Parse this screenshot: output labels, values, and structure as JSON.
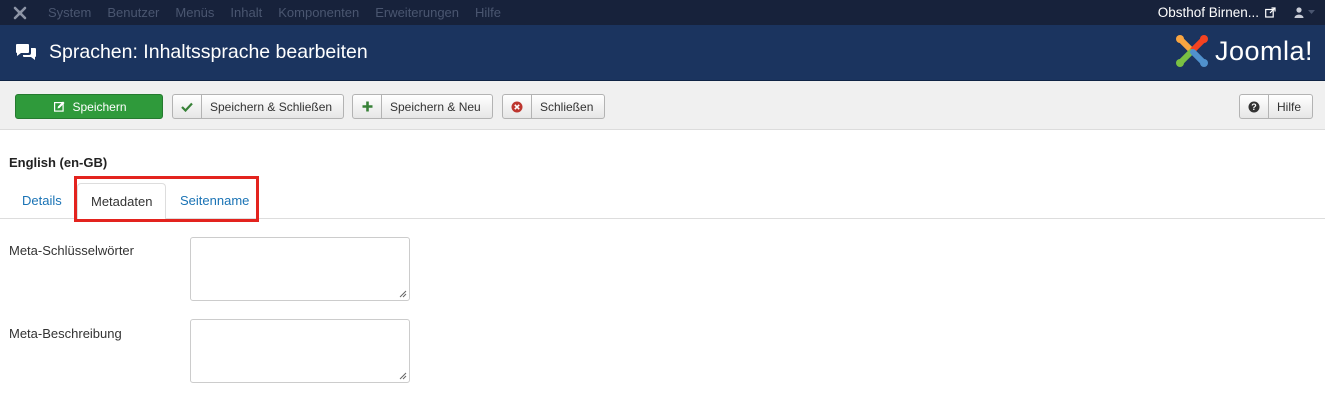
{
  "topbar": {
    "menu": [
      "System",
      "Benutzer",
      "Menüs",
      "Inhalt",
      "Komponenten",
      "Erweiterungen",
      "Hilfe"
    ],
    "site_name": "Obsthof Birnen...",
    "icons": {
      "brand": "joomla-mini-icon",
      "external": "external-link-icon",
      "user": "user-icon"
    }
  },
  "header": {
    "title": "Sprachen: Inhaltssprache bearbeiten",
    "logo_text": "Joomla!",
    "icon": "comments-icon"
  },
  "toolbar": {
    "save": "Speichern",
    "save_close": "Speichern & Schließen",
    "save_new": "Speichern & Neu",
    "close": "Schließen",
    "help": "Hilfe"
  },
  "content": {
    "language_title": "English (en-GB)",
    "tabs": [
      "Details",
      "Metadaten",
      "Seitenname"
    ],
    "active_tab": "Metadaten",
    "fields": [
      {
        "label": "Meta-Schlüsselwörter",
        "value": ""
      },
      {
        "label": "Meta-Beschreibung",
        "value": ""
      }
    ]
  },
  "colors": {
    "topbar": "#17223b",
    "header": "#1b345f",
    "save_button": "#2f9a3b",
    "link": "#1a73b5",
    "highlight": "#e3231e"
  }
}
